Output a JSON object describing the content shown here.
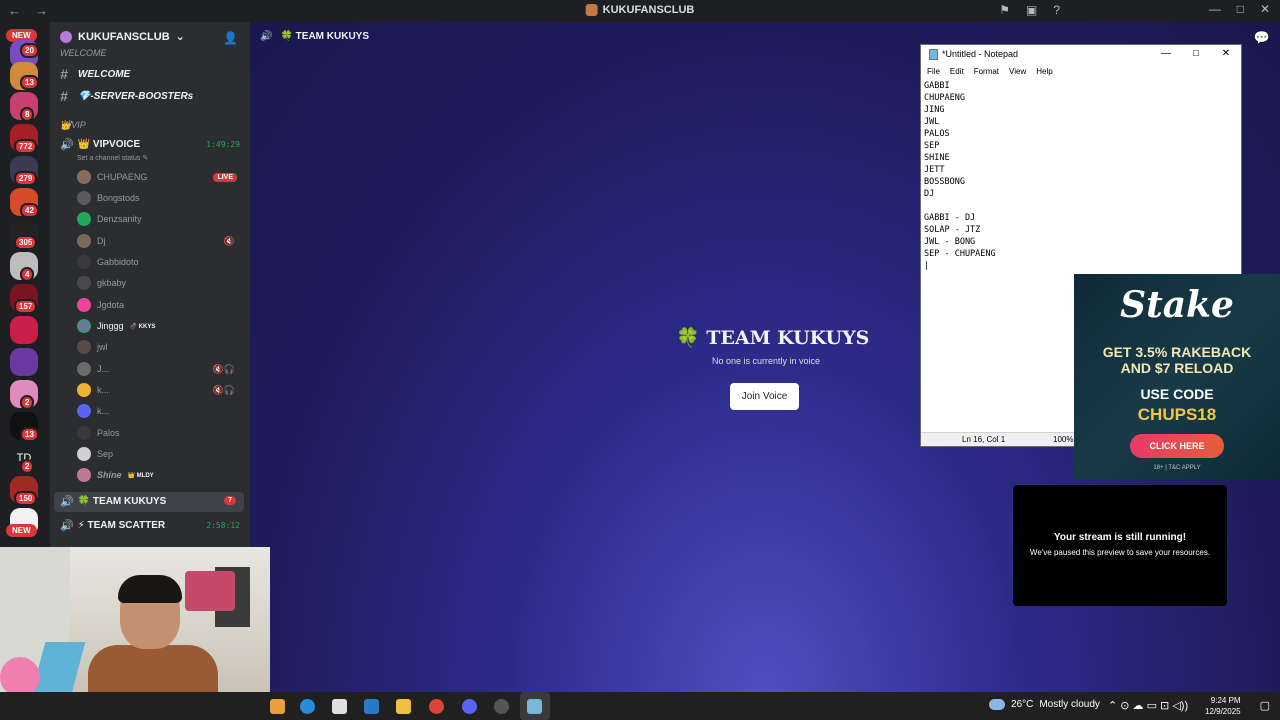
{
  "window": {
    "title": "KUKUFANSCLUB",
    "back_glyph": "←",
    "fwd_glyph": "→",
    "tool_icons": [
      "⚑",
      "▣",
      "?"
    ],
    "ctl": [
      "—",
      "□",
      "✕"
    ]
  },
  "guild_bar": {
    "new_label_top": "NEW",
    "new_label_bottom": "NEW",
    "badges": [
      "20",
      "13",
      "8",
      "772",
      "279",
      "42",
      "305",
      "4",
      "157",
      "2",
      "13",
      "2",
      "150"
    ],
    "td_label": "TD"
  },
  "sidebar": {
    "server_name": "KUKUFANSCLUB",
    "server_chevron": "⌄",
    "add_icon": "👤",
    "category_welcome": "WELCOME",
    "channel_welcome": "WELCOME",
    "channel_boosters": "💎-SERVER-BOOSTERs",
    "category_vip": "👑VIP",
    "vipvoice_name": "👑 VIPVOICE",
    "vipvoice_time": "1:49:29",
    "channel_status": "Set a channel status ✎",
    "users": [
      {
        "name": "CHUPAENG",
        "live": "LIVE"
      },
      {
        "name": "Bongstods"
      },
      {
        "name": "Denzsanity"
      },
      {
        "name": "Dj",
        "mute": "🔇"
      },
      {
        "name": "Gabbidoto"
      },
      {
        "name": "gkbaby"
      },
      {
        "name": "Jgdota"
      },
      {
        "name": "Jinggg",
        "tag": "💣 KKYS"
      },
      {
        "name": "jwl"
      },
      {
        "name": "J...",
        "mute": "🔇🎧"
      },
      {
        "name": "k...",
        "mute": "🔇🎧"
      },
      {
        "name": "k..."
      },
      {
        "name": "Palos"
      },
      {
        "name": "Sep"
      },
      {
        "name": "Shine",
        "tag": "👑 MLDY"
      }
    ],
    "team_kukuys": "🍀 TEAM KUKUYS",
    "team_kukuys_count": "7",
    "team_scatter": "⚡ TEAM SCATTER",
    "team_scatter_time": "2:58:12"
  },
  "stage": {
    "header_title": "🍀 TEAM KUKUYS",
    "title": "🍀 TEAM KUKUYS",
    "subtitle": "No one is currently in voice",
    "join_label": "Join Voice"
  },
  "notepad": {
    "title": "*Untitled - Notepad",
    "menu": [
      "File",
      "Edit",
      "Format",
      "View",
      "Help"
    ],
    "text": "GABBI\nCHUPAENG\nJING\nJWL\nPALOS\nSEP\nSHINE\nJETT\nBOSSBONG\nDJ\n\nGABBI - DJ\nSOLAP - JTZ\nJWL - BONG\nSEP - CHUPAENG\n|",
    "status_pos": "Ln 16, Col 1",
    "status_zoom": "100%"
  },
  "ad": {
    "logo": "Stake",
    "line1": "GET 3.5% RAKEBACK",
    "line2": "AND $7 RELOAD",
    "code_label": "USE CODE",
    "code": "CHUPS18",
    "button": "CLICK HERE",
    "fine": "18+ | T&C APPLY"
  },
  "paused_overlay": {
    "title": "Your stream is still running!",
    "body": "We've paused this preview to save your resources."
  },
  "taskbar": {
    "weather_temp": "26°C",
    "weather_desc": "Mostly cloudy",
    "time": "9:24 PM",
    "date": "12/9/2025",
    "tray": "⌃ ⊙ ☁ ▭ ⊡ ◁))",
    "notif": "▢"
  }
}
